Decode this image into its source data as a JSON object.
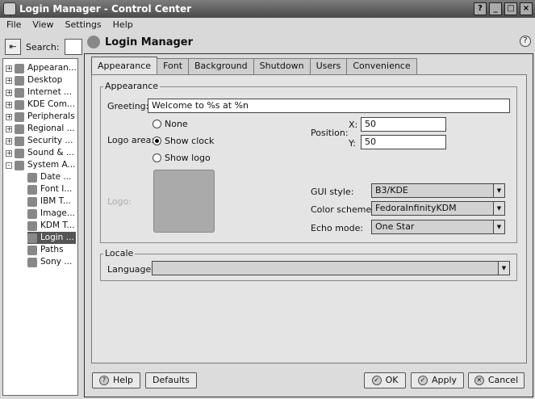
{
  "window": {
    "title": "Login Manager - Control Center",
    "btn_help": "?",
    "btn_min": "_",
    "btn_max": "□",
    "btn_close": "×"
  },
  "menu": [
    "File",
    "View",
    "Settings",
    "Help"
  ],
  "search": {
    "label": "Search:",
    "button_glyph": "⇤"
  },
  "tree": [
    {
      "label": "Appearan...",
      "level": 0,
      "expander": "+"
    },
    {
      "label": "Desktop",
      "level": 0,
      "expander": "+"
    },
    {
      "label": "Internet ...",
      "level": 0,
      "expander": "+"
    },
    {
      "label": "KDE Com...",
      "level": 0,
      "expander": "+"
    },
    {
      "label": "Peripherals",
      "level": 0,
      "expander": "+"
    },
    {
      "label": "Regional ...",
      "level": 0,
      "expander": "+"
    },
    {
      "label": "Security ...",
      "level": 0,
      "expander": "+"
    },
    {
      "label": "Sound & ...",
      "level": 0,
      "expander": "+"
    },
    {
      "label": "System A...",
      "level": 0,
      "expander": "-"
    },
    {
      "label": "Date ...",
      "level": 1
    },
    {
      "label": "Font I...",
      "level": 1
    },
    {
      "label": "IBM T...",
      "level": 1
    },
    {
      "label": "Image...",
      "level": 1
    },
    {
      "label": "KDM T...",
      "level": 1
    },
    {
      "label": "Login ...",
      "level": 1,
      "selected": true
    },
    {
      "label": "Paths",
      "level": 1
    },
    {
      "label": "Sony ...",
      "level": 1
    }
  ],
  "header": {
    "title": "Login Manager",
    "help_glyph": "?"
  },
  "tabs": [
    "Appearance",
    "Font",
    "Background",
    "Shutdown",
    "Users",
    "Convenience"
  ],
  "appearance": {
    "group_title": "Appearance",
    "greeting_label": "Greeting:",
    "greeting_value": "Welcome to %s at %n",
    "logo_area_label": "Logo area:",
    "radio_none": "None",
    "radio_clock": "Show clock",
    "radio_logo": "Show logo",
    "logo_label": "Logo:",
    "position_label": "Position:",
    "x_label": "X:",
    "x_value": "50",
    "y_label": "Y:",
    "y_value": "50",
    "gui_style_label": "GUI style:",
    "gui_style_value": "B3/KDE",
    "color_scheme_label": "Color scheme:",
    "color_scheme_value": "FedoraInfinityKDM",
    "echo_mode_label": "Echo mode:",
    "echo_mode_value": "One Star"
  },
  "locale": {
    "group_title": "Locale",
    "language_label": "Language:",
    "language_value": ""
  },
  "buttons": {
    "help": "Help",
    "defaults": "Defaults",
    "ok": "OK",
    "apply": "Apply",
    "cancel": "Cancel"
  }
}
